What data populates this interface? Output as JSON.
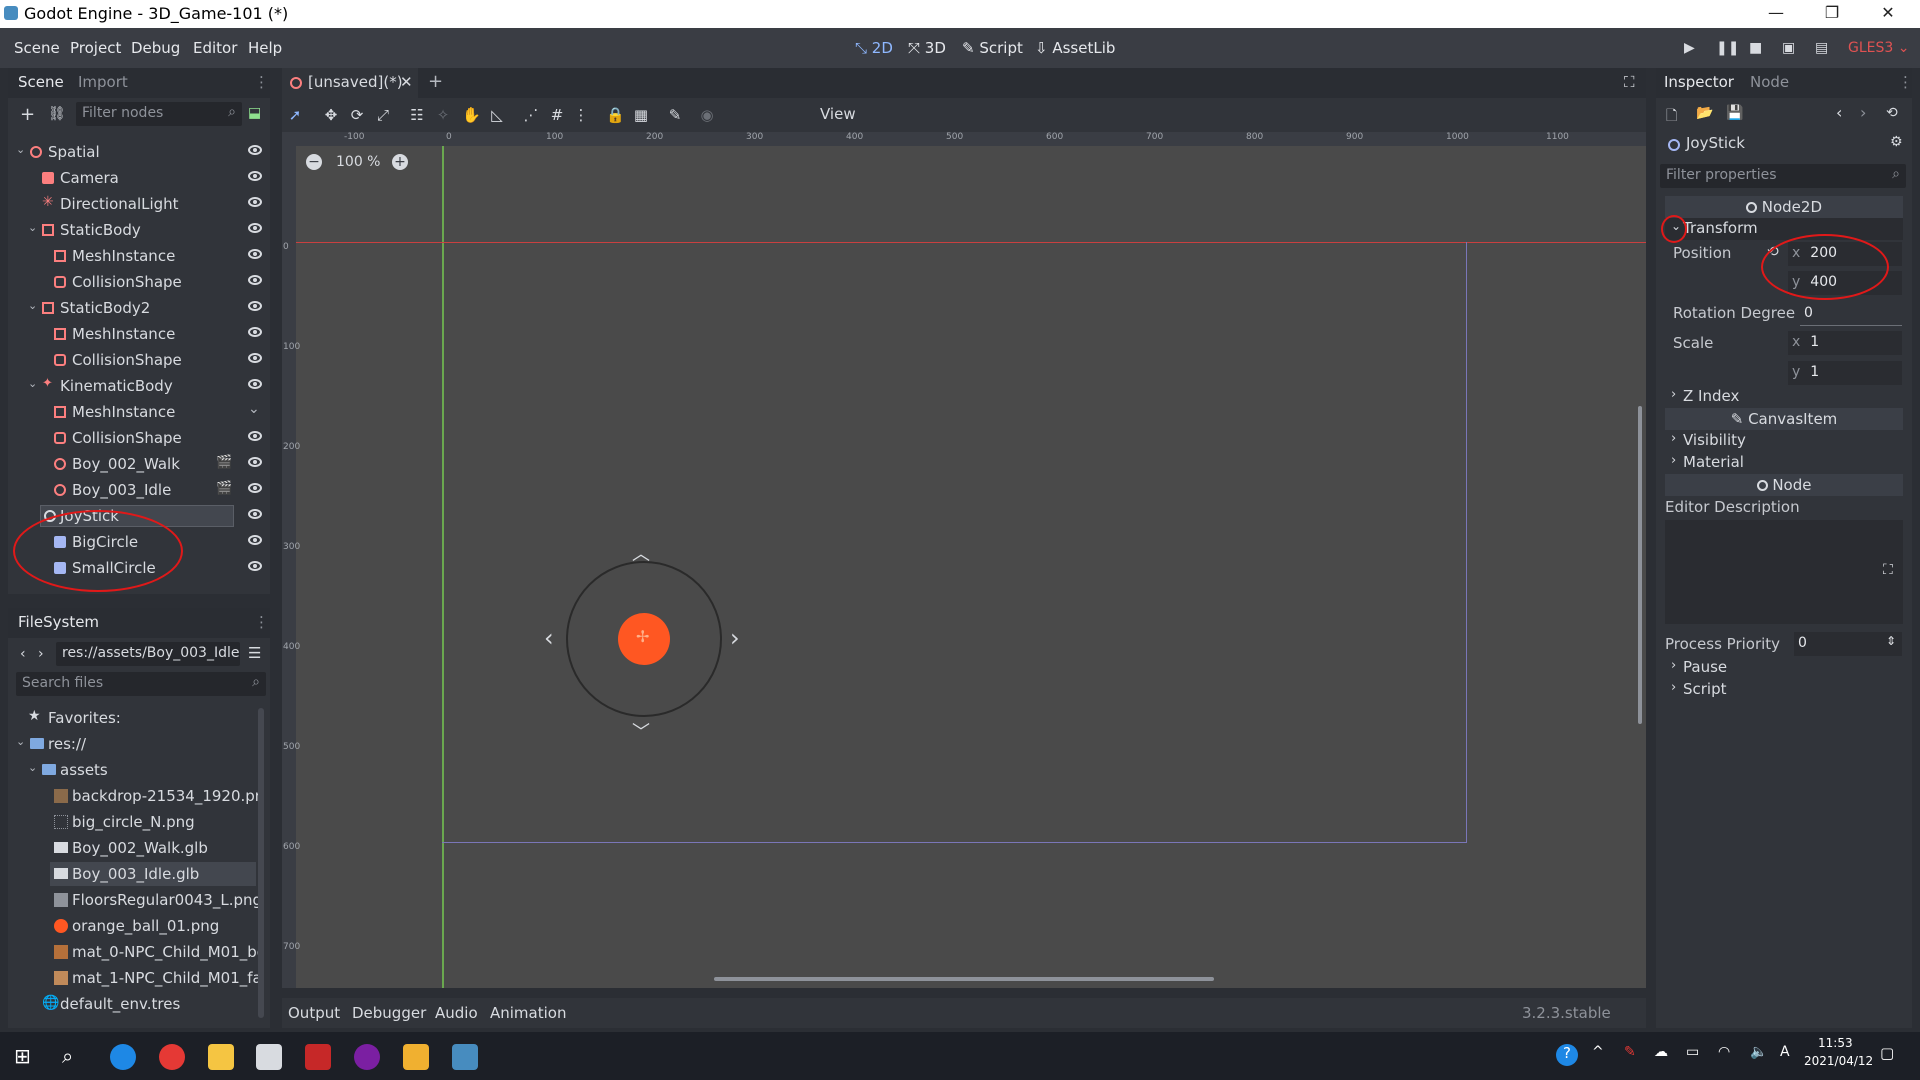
{
  "window": {
    "title": "Godot Engine - 3D_Game-101 (*)"
  },
  "menu": {
    "items": [
      "Scene",
      "Project",
      "Debug",
      "Editor",
      "Help"
    ]
  },
  "modes": {
    "m2d": "2D",
    "m3d": "3D",
    "script": "Script",
    "assetlib": "AssetLib"
  },
  "renderer": "GLES3",
  "scene_dock": {
    "tab_scene": "Scene",
    "tab_import": "Import",
    "filter_placeholder": "Filter nodes",
    "nodes": [
      {
        "label": "Spatial"
      },
      {
        "label": "Camera"
      },
      {
        "label": "DirectionalLight"
      },
      {
        "label": "StaticBody"
      },
      {
        "label": "MeshInstance"
      },
      {
        "label": "CollisionShape"
      },
      {
        "label": "StaticBody2"
      },
      {
        "label": "MeshInstance"
      },
      {
        "label": "CollisionShape"
      },
      {
        "label": "KinematicBody"
      },
      {
        "label": "MeshInstance"
      },
      {
        "label": "CollisionShape"
      },
      {
        "label": "Boy_002_Walk"
      },
      {
        "label": "Boy_003_Idle"
      },
      {
        "label": "JoyStick"
      },
      {
        "label": "BigCircle"
      },
      {
        "label": "SmallCircle"
      }
    ]
  },
  "filesystem": {
    "tab": "FileSystem",
    "path": "res://assets/Boy_003_Idle",
    "search_placeholder": "Search files",
    "items": [
      "Favorites:",
      "res://",
      "assets",
      "backdrop-21534_1920.pn",
      "big_circle_N.png",
      "Boy_002_Walk.glb",
      "Boy_003_Idle.glb",
      "FloorsRegular0043_L.png",
      "orange_ball_01.png",
      "mat_0-NPC_Child_M01_bo",
      "mat_1-NPC_Child_M01_fac",
      "default_env.tres"
    ]
  },
  "editor_tab": {
    "label": "[unsaved](*)"
  },
  "viewport": {
    "view_menu": "View",
    "zoom": "100 %",
    "ruler_h": [
      "-100",
      "0",
      "100",
      "200",
      "300",
      "400",
      "500",
      "600",
      "700",
      "800",
      "900",
      "1000",
      "1100"
    ],
    "ruler_v": [
      "0",
      "100",
      "200",
      "300",
      "400",
      "500",
      "600",
      "700"
    ]
  },
  "inspector": {
    "tab_inspector": "Inspector",
    "tab_node": "Node",
    "node_name": "JoyStick",
    "filter_placeholder": "Filter properties",
    "section_node2d": "Node2D",
    "transform": "Transform",
    "position_label": "Position",
    "pos_x_axis": "x",
    "pos_x": "200",
    "pos_y_axis": "y",
    "pos_y": "400",
    "rotation_label": "Rotation Degree",
    "rotation": "0",
    "scale_label": "Scale",
    "scale_x_axis": "x",
    "scale_x": "1",
    "scale_y_axis": "y",
    "scale_y": "1",
    "z_index": "Z Index",
    "section_canvasitem": "CanvasItem",
    "visibility": "Visibility",
    "material": "Material",
    "section_node": "Node",
    "editor_description": "Editor Description",
    "process_priority_label": "Process Priority",
    "process_priority": "0",
    "pause": "Pause",
    "script": "Script"
  },
  "bottom": {
    "tabs": [
      "Output",
      "Debugger",
      "Audio",
      "Animation"
    ],
    "version": "3.2.3.stable"
  },
  "taskbar": {
    "time": "11:53",
    "date": "2021/04/12",
    "ime": "A"
  },
  "colors": {
    "accent": "#8fb8ff",
    "orange": "#ff5722",
    "annotation": "#e01919",
    "node3d": "#fc7f7f",
    "node2d": "#a5b7f3"
  }
}
